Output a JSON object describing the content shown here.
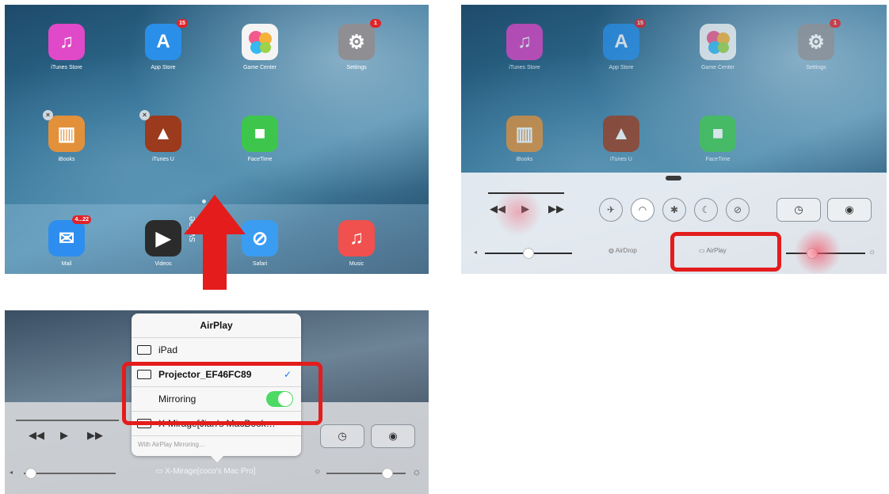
{
  "home": {
    "apps": [
      {
        "label": "iTunes Store",
        "glyph": "♫",
        "color": "#e049c8"
      },
      {
        "label": "App Store",
        "glyph": "A",
        "color": "#2a8fe8",
        "badge": "15"
      },
      {
        "label": "Game Center",
        "glyph": "●",
        "color": "#f2f2f2"
      },
      {
        "label": "Settings",
        "glyph": "⚙",
        "color": "#8e8e93",
        "badge": "1"
      },
      {
        "label": "iBooks",
        "glyph": "▥",
        "color": "#e2913a"
      },
      {
        "label": "iTunes U",
        "glyph": "▲",
        "color": "#9b3a1c"
      },
      {
        "label": "FaceTime",
        "glyph": "■",
        "color": "#3ec64c"
      }
    ],
    "dock": [
      {
        "label": "Mail",
        "glyph": "✉",
        "color": "#2d8ef0",
        "badge": "4...22"
      },
      {
        "label": "Videos",
        "glyph": "▶",
        "color": "#2b2b2b"
      },
      {
        "label": "Safari",
        "glyph": "⊘",
        "color": "#3a9df2"
      },
      {
        "label": "Music",
        "glyph": "♫",
        "color": "#f0504e"
      }
    ],
    "swipe_text": "swipe"
  },
  "control_center": {
    "airdrop_label": "AirDrop",
    "airplay_label": "AirPlay",
    "toggles": [
      "✈",
      "◠",
      "✱",
      "☾",
      "⊘"
    ],
    "timer_icon": "◷",
    "camera_icon": "◉"
  },
  "airplay_popup": {
    "title": "AirPlay",
    "devices": [
      {
        "name": "iPad",
        "selected": false
      },
      {
        "name": "Projector_EF46FC89",
        "selected": true
      },
      {
        "name": "X-Mirage[Jian's MacBook…",
        "selected": false
      }
    ],
    "checkmark": "✓",
    "mirroring_label": "Mirroring",
    "mirroring_on": true,
    "footer_hint": "With AirPlay Mirroring…",
    "airplay_target": "X-Mirage[coco's Mac Pro]"
  },
  "colors": {
    "highlight": "#e41c1c",
    "toggle_on": "#4cd964"
  }
}
